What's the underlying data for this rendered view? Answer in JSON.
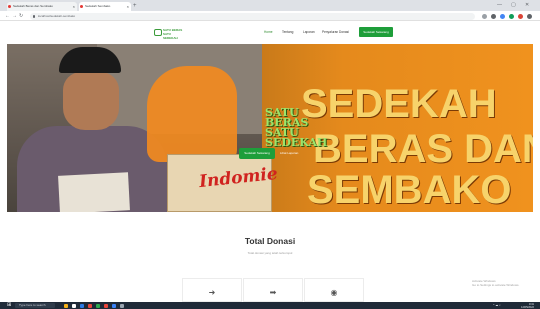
{
  "browser": {
    "tabs": [
      {
        "title": "Sedekah Beras dan Sembako"
      },
      {
        "title": "Sedekah Sembako"
      }
    ],
    "new_tab_icon": "+",
    "url": "localhost/sedekah-sembako",
    "window_controls": [
      "—",
      "▢",
      "✕"
    ]
  },
  "site_nav": {
    "logo_text": "SATU BERAS SATU SEDEKAH",
    "menu": [
      "Home",
      "Tentang",
      "Laporan",
      "Penyaluran Donasi"
    ],
    "cta_label": "Sedekah Sekarang"
  },
  "hero": {
    "brand_text": "SATU BERAS SATU SEDEKAH",
    "headline": [
      "SEDEKAH",
      "BERAS DAN",
      "SEMBAKO"
    ],
    "box_label": "Indomie",
    "primary_button": "Sedekah Sekarang",
    "secondary_link": "Lihat Laporan"
  },
  "total_donasi": {
    "title": "Total Donasi",
    "subtitle": "Total donasi yang telah terkumpul",
    "cards": [
      {
        "icon": "sign-in-icon",
        "glyph": "➜"
      },
      {
        "icon": "sign-out-icon",
        "glyph": "➡"
      },
      {
        "icon": "circle-icon",
        "glyph": "◉"
      }
    ]
  },
  "windows_watermark": {
    "line1": "Activate Windows",
    "line2": "Go to Settings to activate Windows."
  },
  "taskbar": {
    "start_glyph": "⊞",
    "search_placeholder": "Type here to search",
    "tray": "^ ☁ ♪",
    "time": "9:41",
    "date": "12/05/2022"
  },
  "colors": {
    "brand_green": "#1e9e3a",
    "hero_orange": "#f0921e",
    "headline_yellow": "#f7d36b"
  }
}
